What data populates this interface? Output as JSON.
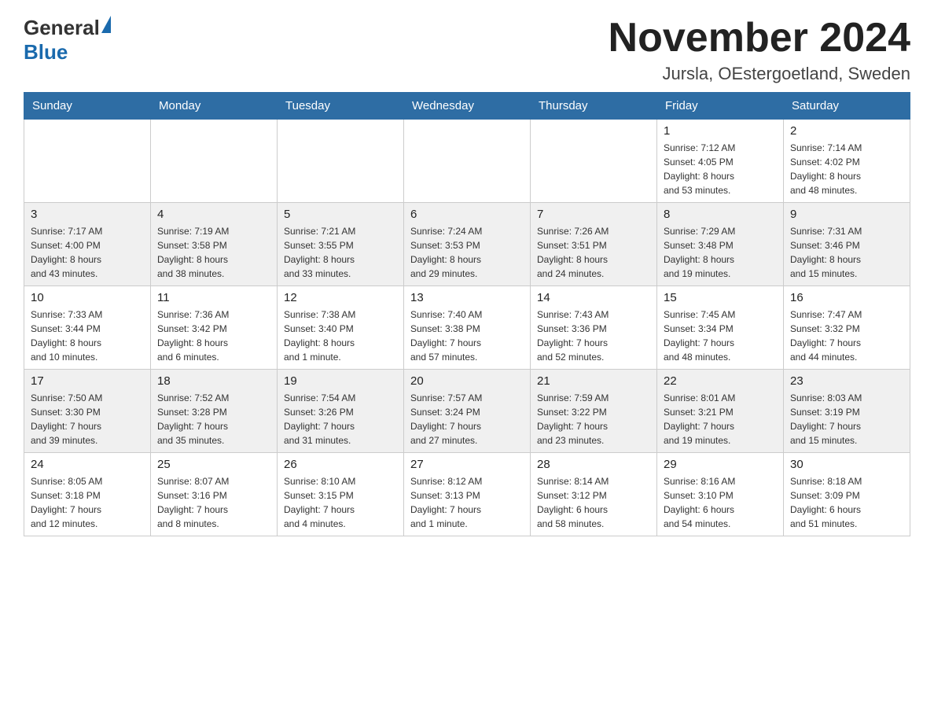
{
  "header": {
    "logo_general": "General",
    "logo_blue": "Blue",
    "title": "November 2024",
    "subtitle": "Jursla, OEstergoetland, Sweden"
  },
  "days_of_week": [
    "Sunday",
    "Monday",
    "Tuesday",
    "Wednesday",
    "Thursday",
    "Friday",
    "Saturday"
  ],
  "weeks": [
    [
      {
        "day": "",
        "info": ""
      },
      {
        "day": "",
        "info": ""
      },
      {
        "day": "",
        "info": ""
      },
      {
        "day": "",
        "info": ""
      },
      {
        "day": "",
        "info": ""
      },
      {
        "day": "1",
        "info": "Sunrise: 7:12 AM\nSunset: 4:05 PM\nDaylight: 8 hours\nand 53 minutes."
      },
      {
        "day": "2",
        "info": "Sunrise: 7:14 AM\nSunset: 4:02 PM\nDaylight: 8 hours\nand 48 minutes."
      }
    ],
    [
      {
        "day": "3",
        "info": "Sunrise: 7:17 AM\nSunset: 4:00 PM\nDaylight: 8 hours\nand 43 minutes."
      },
      {
        "day": "4",
        "info": "Sunrise: 7:19 AM\nSunset: 3:58 PM\nDaylight: 8 hours\nand 38 minutes."
      },
      {
        "day": "5",
        "info": "Sunrise: 7:21 AM\nSunset: 3:55 PM\nDaylight: 8 hours\nand 33 minutes."
      },
      {
        "day": "6",
        "info": "Sunrise: 7:24 AM\nSunset: 3:53 PM\nDaylight: 8 hours\nand 29 minutes."
      },
      {
        "day": "7",
        "info": "Sunrise: 7:26 AM\nSunset: 3:51 PM\nDaylight: 8 hours\nand 24 minutes."
      },
      {
        "day": "8",
        "info": "Sunrise: 7:29 AM\nSunset: 3:48 PM\nDaylight: 8 hours\nand 19 minutes."
      },
      {
        "day": "9",
        "info": "Sunrise: 7:31 AM\nSunset: 3:46 PM\nDaylight: 8 hours\nand 15 minutes."
      }
    ],
    [
      {
        "day": "10",
        "info": "Sunrise: 7:33 AM\nSunset: 3:44 PM\nDaylight: 8 hours\nand 10 minutes."
      },
      {
        "day": "11",
        "info": "Sunrise: 7:36 AM\nSunset: 3:42 PM\nDaylight: 8 hours\nand 6 minutes."
      },
      {
        "day": "12",
        "info": "Sunrise: 7:38 AM\nSunset: 3:40 PM\nDaylight: 8 hours\nand 1 minute."
      },
      {
        "day": "13",
        "info": "Sunrise: 7:40 AM\nSunset: 3:38 PM\nDaylight: 7 hours\nand 57 minutes."
      },
      {
        "day": "14",
        "info": "Sunrise: 7:43 AM\nSunset: 3:36 PM\nDaylight: 7 hours\nand 52 minutes."
      },
      {
        "day": "15",
        "info": "Sunrise: 7:45 AM\nSunset: 3:34 PM\nDaylight: 7 hours\nand 48 minutes."
      },
      {
        "day": "16",
        "info": "Sunrise: 7:47 AM\nSunset: 3:32 PM\nDaylight: 7 hours\nand 44 minutes."
      }
    ],
    [
      {
        "day": "17",
        "info": "Sunrise: 7:50 AM\nSunset: 3:30 PM\nDaylight: 7 hours\nand 39 minutes."
      },
      {
        "day": "18",
        "info": "Sunrise: 7:52 AM\nSunset: 3:28 PM\nDaylight: 7 hours\nand 35 minutes."
      },
      {
        "day": "19",
        "info": "Sunrise: 7:54 AM\nSunset: 3:26 PM\nDaylight: 7 hours\nand 31 minutes."
      },
      {
        "day": "20",
        "info": "Sunrise: 7:57 AM\nSunset: 3:24 PM\nDaylight: 7 hours\nand 27 minutes."
      },
      {
        "day": "21",
        "info": "Sunrise: 7:59 AM\nSunset: 3:22 PM\nDaylight: 7 hours\nand 23 minutes."
      },
      {
        "day": "22",
        "info": "Sunrise: 8:01 AM\nSunset: 3:21 PM\nDaylight: 7 hours\nand 19 minutes."
      },
      {
        "day": "23",
        "info": "Sunrise: 8:03 AM\nSunset: 3:19 PM\nDaylight: 7 hours\nand 15 minutes."
      }
    ],
    [
      {
        "day": "24",
        "info": "Sunrise: 8:05 AM\nSunset: 3:18 PM\nDaylight: 7 hours\nand 12 minutes."
      },
      {
        "day": "25",
        "info": "Sunrise: 8:07 AM\nSunset: 3:16 PM\nDaylight: 7 hours\nand 8 minutes."
      },
      {
        "day": "26",
        "info": "Sunrise: 8:10 AM\nSunset: 3:15 PM\nDaylight: 7 hours\nand 4 minutes."
      },
      {
        "day": "27",
        "info": "Sunrise: 8:12 AM\nSunset: 3:13 PM\nDaylight: 7 hours\nand 1 minute."
      },
      {
        "day": "28",
        "info": "Sunrise: 8:14 AM\nSunset: 3:12 PM\nDaylight: 6 hours\nand 58 minutes."
      },
      {
        "day": "29",
        "info": "Sunrise: 8:16 AM\nSunset: 3:10 PM\nDaylight: 6 hours\nand 54 minutes."
      },
      {
        "day": "30",
        "info": "Sunrise: 8:18 AM\nSunset: 3:09 PM\nDaylight: 6 hours\nand 51 minutes."
      }
    ]
  ]
}
